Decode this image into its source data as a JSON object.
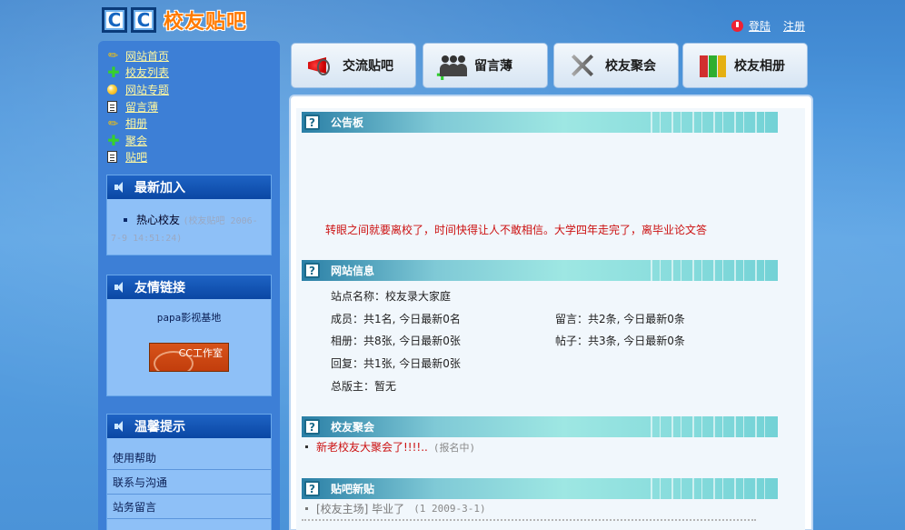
{
  "header": {
    "logo_letters": "CC",
    "logo_text": "校友贴吧",
    "login": "登陆",
    "register": "注册"
  },
  "nav": [
    {
      "label": "网站首页",
      "icon": "pencil-icon"
    },
    {
      "label": "校友列表",
      "icon": "plus-icon"
    },
    {
      "label": "网站专题",
      "icon": "globe-icon"
    },
    {
      "label": "留言薄",
      "icon": "document-icon"
    },
    {
      "label": "相册",
      "icon": "pencil-icon"
    },
    {
      "label": "聚会",
      "icon": "plus-icon"
    },
    {
      "label": "贴吧",
      "icon": "document-icon"
    }
  ],
  "newest": {
    "title": "最新加入",
    "name": "热心校友",
    "meta": "(校友贴吧 2006-7-9 14:51:24)"
  },
  "links": {
    "title": "友情链接",
    "site": "papa影视基地",
    "banner": "CC工作室"
  },
  "tips": {
    "title": "温馨提示",
    "items": [
      "使用帮助",
      "联系与沟通",
      "站务留言"
    ]
  },
  "tabs": [
    {
      "label": "交流贴吧",
      "icon": "megaphone-icon"
    },
    {
      "label": "留言薄",
      "icon": "people-icon"
    },
    {
      "label": "校友聚会",
      "icon": "tools-icon"
    },
    {
      "label": "校友相册",
      "icon": "books-icon"
    }
  ],
  "sections": {
    "board": "公告板",
    "info": "网站信息",
    "party": "校友聚会",
    "posts": "贴吧新贴"
  },
  "notice": "转眼之间就要离校了，时间快得让人不敢相信。大学四年走完了，离毕业论文答",
  "site_info": {
    "name": "站点名称：校友录大家庭",
    "members": "成员：共1名, 今日最新0名",
    "messages": "留言：共2条, 今日最新0条",
    "photos": "相册：共8张, 今日最新0张",
    "threads": "帖子：共3条, 今日最新0条",
    "replies": "回复：共1张, 今日最新0张",
    "admin": "总版主：暂无"
  },
  "party": {
    "title": "新老校友大聚会了!!!!..",
    "status": "(报名中)"
  },
  "post": {
    "title": "[校友主场] 毕业了",
    "date": "(1 2009-3-1)"
  },
  "colors": {
    "accent": "#3d7fd6",
    "notice_red": "#cc1111",
    "logo_orange": "#ff7a00"
  }
}
